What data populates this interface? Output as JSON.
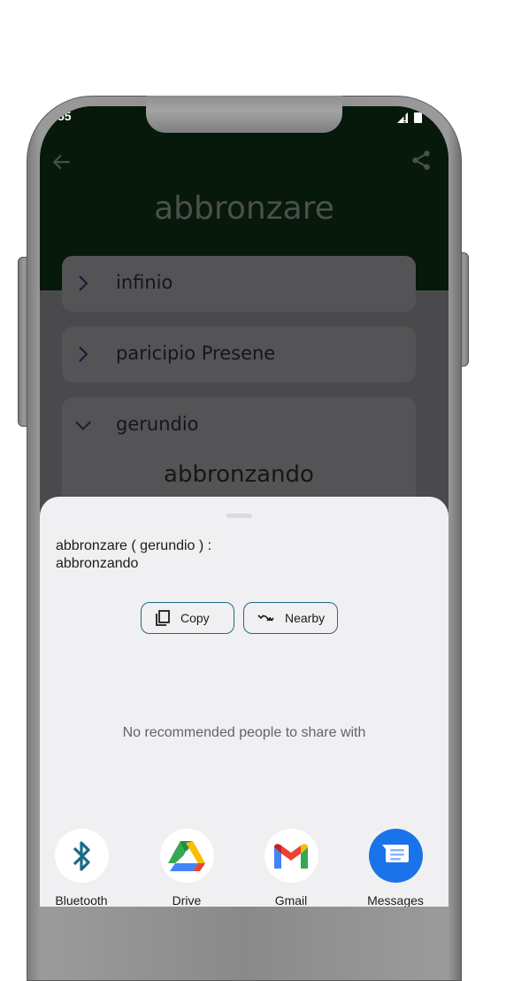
{
  "status_bar": {
    "time": "55",
    "icons": [
      "signal-alert-icon",
      "battery-icon"
    ]
  },
  "header": {
    "back_icon": "arrow-left-icon",
    "share_icon": "share-icon",
    "title": "abbronzare"
  },
  "sections": [
    {
      "label": "infinio",
      "expanded": false,
      "icon": "chevron-right-icon"
    },
    {
      "label": "paricipio Presene",
      "expanded": false,
      "icon": "chevron-right-icon"
    },
    {
      "label": "gerundio",
      "expanded": true,
      "icon": "chevron-down-icon",
      "value": "abbronzando"
    }
  ],
  "share_sheet": {
    "text": "abbronzare ( gerundio )  :\nabbronzando",
    "actions": [
      {
        "label": "Copy",
        "icon": "copy-icon"
      },
      {
        "label": "Nearby",
        "icon": "nearby-share-icon"
      }
    ],
    "no_people_message": "No recommended people to share with",
    "apps": [
      {
        "label": "Bluetooth",
        "icon": "bluetooth-icon"
      },
      {
        "label": "Drive",
        "icon": "google-drive-icon"
      },
      {
        "label": "Gmail",
        "icon": "gmail-icon"
      },
      {
        "label": "Messages",
        "icon": "messages-icon"
      }
    ]
  },
  "colors": {
    "header_bg": "#06190b",
    "scrim_bg": "#4a4a4d",
    "sheet_bg": "#f0f0f2",
    "chip_border": "#1f6c7e",
    "bluetooth": "#1b6a85",
    "messages": "#1a73e8"
  }
}
